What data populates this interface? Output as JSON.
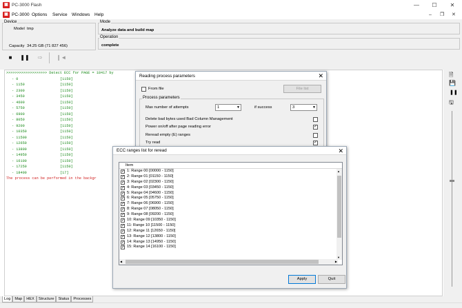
{
  "window": {
    "title": "PC-3000 Flash",
    "minimize": "—",
    "maximize": "☐",
    "close": "✕"
  },
  "menu": {
    "app_label": "PC-3000",
    "items": [
      "Options",
      "Service",
      "Windows",
      "Help"
    ]
  },
  "device": {
    "group_title": "Device",
    "model_label": "Model",
    "model_value": "tmp",
    "capacity_label": "Capacity",
    "capacity_value": "34.25 GB (71 827 456)"
  },
  "mode": {
    "group_title": "Mode",
    "value": "Analyze data and build map"
  },
  "operation": {
    "group_title": "Operation",
    "value": "complete"
  },
  "log": {
    "header": ">>>>>>>>>>>>>>>>>>> Detect ECC for PAGE = 18417 by",
    "rows": [
      {
        "offset": "- 0",
        "value": "[1150]"
      },
      {
        "offset": "- 1150",
        "value": "[1150]"
      },
      {
        "offset": "- 2300",
        "value": "[1150]"
      },
      {
        "offset": "- 3450",
        "value": "[1150]"
      },
      {
        "offset": "- 4600",
        "value": "[1150]"
      },
      {
        "offset": "- 5750",
        "value": "[1150]"
      },
      {
        "offset": "- 6900",
        "value": "[1150]"
      },
      {
        "offset": "- 8050",
        "value": "[1150]"
      },
      {
        "offset": "- 9200",
        "value": "[1150]"
      },
      {
        "offset": "- 10350",
        "value": "[1150]"
      },
      {
        "offset": "- 11500",
        "value": "[1150]"
      },
      {
        "offset": "- 12650",
        "value": "[1150]"
      },
      {
        "offset": "- 13800",
        "value": "[1150]"
      },
      {
        "offset": "- 14950",
        "value": "[1150]"
      },
      {
        "offset": "- 16100",
        "value": "[1150]"
      },
      {
        "offset": "- 17250",
        "value": "[1150]"
      },
      {
        "offset": "- 18400",
        "value": "[17]"
      }
    ],
    "footer": "The process can be performed in the backgr"
  },
  "reading_dialog": {
    "title": "Reading process parameters",
    "from_file_label": "From file",
    "file_list_button": "File list",
    "group_title": "Process parameters",
    "max_attempts_label": "Max number of attempts",
    "max_attempts_value": "1",
    "if_success_label": "if success",
    "if_success_value": "3",
    "options": [
      {
        "label": "Delete bad bytes used Bad Column Management",
        "checked": false
      },
      {
        "label": "Power on/off after page reading error",
        "checked": true
      },
      {
        "label": "Reread empty (E) ranges",
        "checked": false
      },
      {
        "label": "Try read",
        "checked": true
      }
    ]
  },
  "ecc_dialog": {
    "title": "ECC ranges list for reread",
    "column_header": "Item",
    "items": [
      "1: Range 00 [00000 - 1150]",
      "2: Range 01 [01150 - 1150]",
      "3: Range 02 [02300 - 1150]",
      "4: Range 03 [03450 - 1150]",
      "5: Range 04 [04600 - 1150]",
      "6: Range 05 [05750 - 1150]",
      "7: Range 06 [06900 - 1150]",
      "8: Range 07 [08050 - 1150]",
      "9: Range 08 [09200 - 1150]",
      "10: Range 09 [10350 - 1150]",
      "11: Range 10 [11500 - 1150]",
      "12: Range 11 [12650 - 1150]",
      "13: Range 12 [13800 - 1150]",
      "14: Range 13 [14950 - 1150]",
      "15: Range 14 [16100 - 1150]"
    ],
    "apply_button": "Apply",
    "quit_button": "Quit"
  },
  "tabs": [
    "Log",
    "Map",
    "HEX",
    "Structure",
    "Status",
    "Processes"
  ],
  "active_tab": "Log",
  "colors": {
    "log_text": "#1a8a1a",
    "log_warning": "#d02020",
    "app_icon": "#d82020"
  }
}
